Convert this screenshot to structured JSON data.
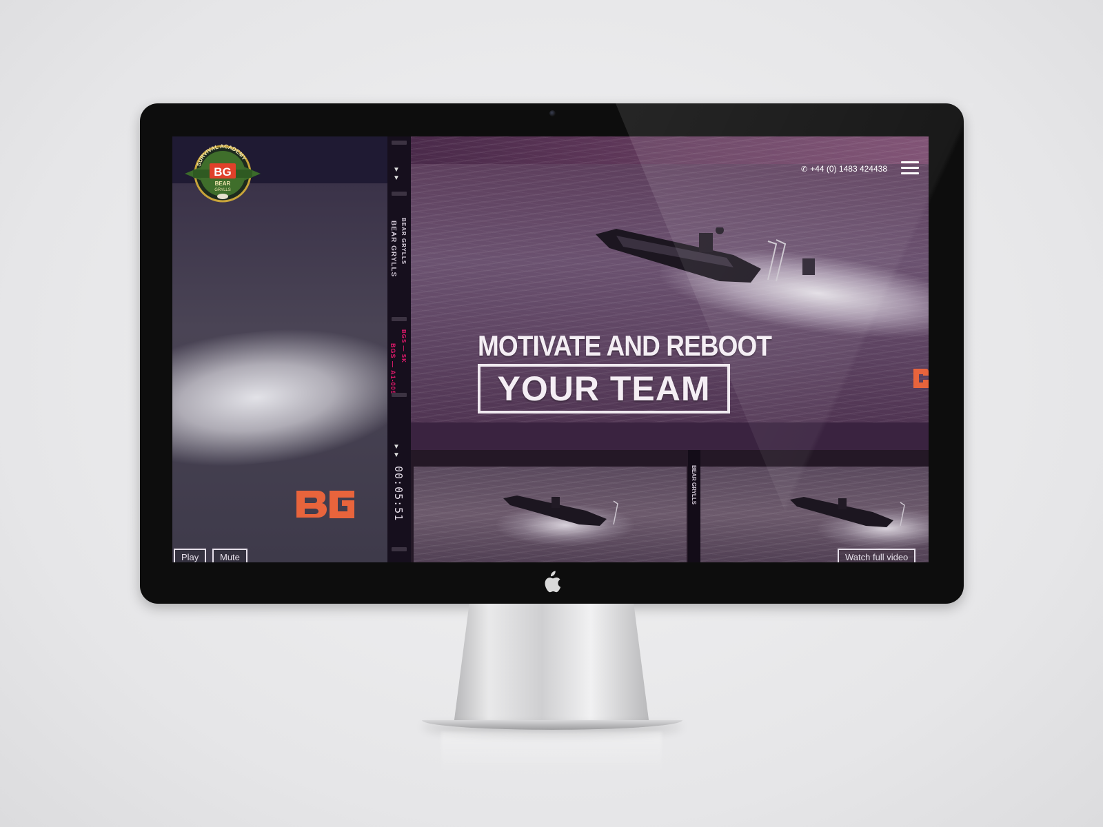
{
  "header": {
    "phone": "+44 (0) 1483 424438",
    "menu_icon": "hamburger-menu-icon"
  },
  "logo": {
    "arc_text": "SURVIVAL ACADEMY",
    "initials": "BG",
    "name_line1": "BEAR",
    "name_line2": "GRYLLS"
  },
  "hero": {
    "headline": "MOTIVATE AND REBOOT",
    "subhead": "YOUR TEAM"
  },
  "film_strip": {
    "label": "BEAR GRYLLS",
    "label_small": "BEAR GRYLLS",
    "code1": "BGS — A1-009",
    "code2": "BGS — SK",
    "timecode": "00:05:51"
  },
  "controls": {
    "play": "Play",
    "mute": "Mute",
    "watch": "Watch full video"
  },
  "colors": {
    "accent": "#e0196b",
    "brand_orange": "#e8643c",
    "overlay": "#6b4a6c"
  }
}
